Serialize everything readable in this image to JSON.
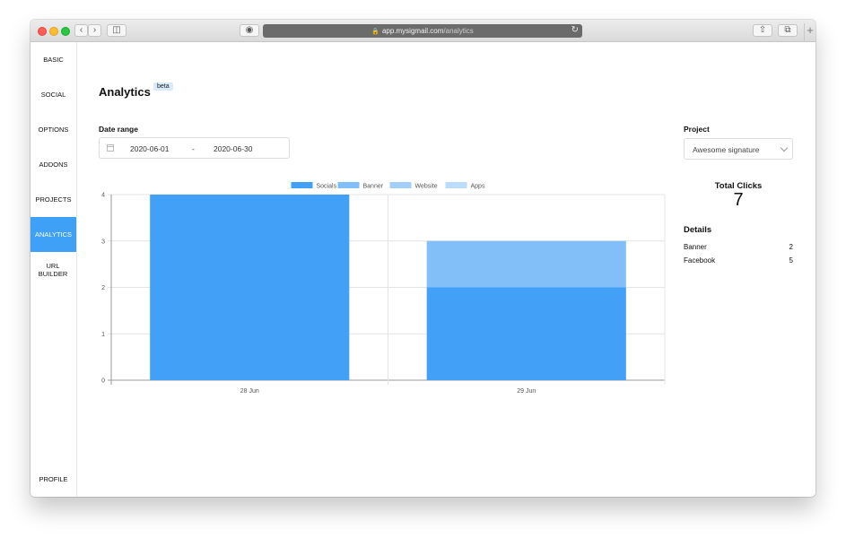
{
  "browser": {
    "url_host": "app.mysigmail.com",
    "url_path": "/analytics"
  },
  "sidebar": {
    "items": [
      {
        "label": "BASIC",
        "key": "basic"
      },
      {
        "label": "SOCIAL",
        "key": "social"
      },
      {
        "label": "OPTIONS",
        "key": "options"
      },
      {
        "label": "ADDONS",
        "key": "addons"
      },
      {
        "label": "PROJECTS",
        "key": "projects"
      },
      {
        "label": "ANALYTICS",
        "key": "analytics",
        "active": true
      },
      {
        "label": "URL BUILDER",
        "key": "url-builder"
      }
    ],
    "profile_label": "PROFILE"
  },
  "page": {
    "title": "Analytics",
    "badge": "beta"
  },
  "date_range": {
    "label": "Date range",
    "start": "2020-06-01",
    "separator": "-",
    "end": "2020-06-30"
  },
  "project": {
    "label": "Project",
    "selected": "Awesome signature"
  },
  "summary": {
    "total_label": "Total Clicks",
    "total_value": "7",
    "details_title": "Details",
    "details": [
      {
        "name": "Banner",
        "count": "2"
      },
      {
        "name": "Facebook",
        "count": "5"
      }
    ]
  },
  "chart_data": {
    "type": "bar",
    "stacked": true,
    "categories": [
      "28 Jun",
      "29 Jun"
    ],
    "series": [
      {
        "name": "Socials",
        "values": [
          4,
          2
        ],
        "color": "#42a0f7"
      },
      {
        "name": "Banner",
        "values": [
          0,
          1
        ],
        "color": "#82bff9"
      },
      {
        "name": "Website",
        "values": [
          0,
          0
        ],
        "color": "#a3cffa"
      },
      {
        "name": "Apps",
        "values": [
          0,
          0
        ],
        "color": "#bcdcfb"
      }
    ],
    "ylim": [
      0,
      4
    ],
    "yticks": [
      0,
      1,
      2,
      3,
      4
    ],
    "grid": true,
    "legend": "top"
  }
}
